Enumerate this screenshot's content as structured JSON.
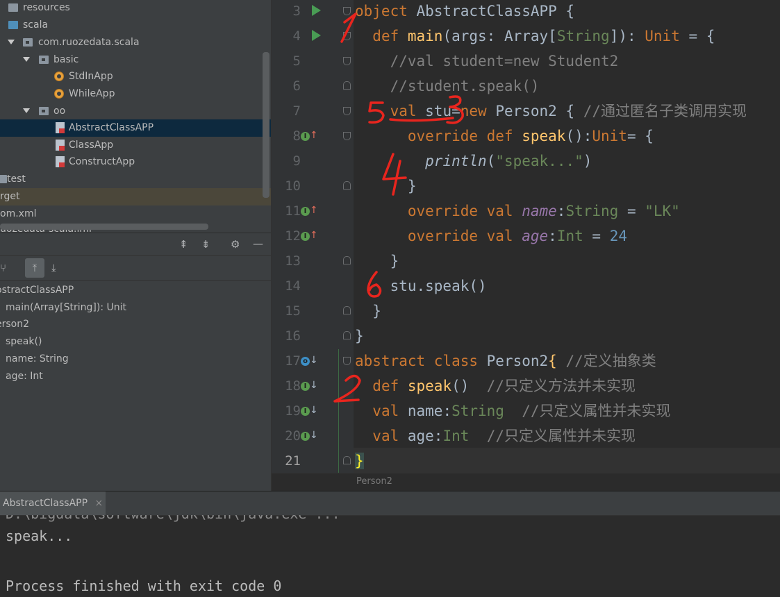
{
  "project_tree": {
    "items": [
      {
        "label": "resources",
        "icon": "folder-resources-icon",
        "depth": 0
      },
      {
        "label": "scala",
        "icon": "folder-source-icon",
        "depth": 0
      },
      {
        "label": "com.ruozedata.scala",
        "icon": "package-icon",
        "depth": 1
      },
      {
        "label": "basic",
        "icon": "package-icon",
        "depth": 2
      },
      {
        "label": "StdInApp",
        "icon": "scala-object-icon",
        "depth": 3
      },
      {
        "label": "WhileApp",
        "icon": "scala-object-icon",
        "depth": 3
      },
      {
        "label": "oo",
        "icon": "package-icon",
        "depth": 2
      },
      {
        "label": "AbstractClassAPP",
        "icon": "scala-file-icon",
        "depth": 3,
        "selected": true
      },
      {
        "label": "ClassApp",
        "icon": "scala-file-icon",
        "depth": 3
      },
      {
        "label": "ConstructApp",
        "icon": "scala-file-icon",
        "depth": 3
      },
      {
        "label": "test",
        "icon": "folder-icon",
        "depth": 0
      },
      {
        "label": "rget",
        "icon": "folder-icon",
        "depth": 0
      },
      {
        "label": "om.xml",
        "icon": "xml-file-icon",
        "depth": 0
      },
      {
        "label": "uozedata-scala.iml",
        "icon": "iml-file-icon",
        "depth": 0
      }
    ]
  },
  "structure": {
    "items": [
      {
        "label": "ostractClassAPP"
      },
      {
        "label": "main(Array[String]): Unit"
      },
      {
        "label": "erson2"
      },
      {
        "label": "speak()"
      },
      {
        "label": "name: String"
      },
      {
        "label": "age: Int"
      }
    ]
  },
  "editor": {
    "line_numbers": [
      "3",
      "4",
      "5",
      "6",
      "7",
      "8",
      "9",
      "10",
      "11",
      "12",
      "13",
      "14",
      "15",
      "16",
      "17",
      "18",
      "19",
      "20",
      "21"
    ],
    "current_line": "21",
    "lines": {
      "l3": {
        "kw": "object",
        "name": " AbstractClassAPP {"
      },
      "l4": {
        "indent": "  ",
        "kw": "def",
        "fn": " main",
        "p1": "(args: Array[",
        "ty": "String",
        "p2": "]): ",
        "ret": "Unit",
        "p3": " = {"
      },
      "l5": {
        "text": "    //val student=new Student2"
      },
      "l6": {
        "text": "    //student.speak()"
      },
      "l7": {
        "indent": "    ",
        "kw": "val",
        "p1": " stu=",
        "kw2": "new",
        "p2": " Person2 { ",
        "cm": "//通过匿名子类调用实现"
      },
      "l8": {
        "indent": "      ",
        "kw": "override def",
        "fn": " speak",
        "p1": "():",
        "ret": "Unit",
        "p2": "= {"
      },
      "l9": {
        "indent": "        ",
        "fn": "println",
        "p1": "(",
        "st": "\"speak...\"",
        "p2": ")"
      },
      "l10": {
        "text": "      }"
      },
      "l11": {
        "indent": "      ",
        "kw": "override val",
        "pr": " name",
        "p1": ":",
        "ty": "String",
        "p2": " = ",
        "st": "\"LK\""
      },
      "l12": {
        "indent": "      ",
        "kw": "override val",
        "pr": " age",
        "p1": ":",
        "ty": "Int",
        "p2": " = ",
        "nm": "24"
      },
      "l13": {
        "text": "    }"
      },
      "l14": {
        "text": "    stu.speak()"
      },
      "l15": {
        "text": "  }"
      },
      "l16": {
        "text": "}"
      },
      "l17": {
        "kw": "abstract class",
        "p1": " Person2",
        "brk": "{",
        "p2": " ",
        "cm": "//定义抽象类"
      },
      "l18": {
        "indent": "  ",
        "kw": "def",
        "fn": " speak",
        "p1": "()  ",
        "cm": "//只定义方法并未实现"
      },
      "l19": {
        "indent": "  ",
        "kw": "val",
        "p1": " name:",
        "ty": "String",
        "p2": "  ",
        "cm": "//只定义属性并未实现"
      },
      "l20": {
        "indent": "  ",
        "kw": "val",
        "p1": " age:",
        "ty": "Int",
        "p2": "  ",
        "cm": "//只定义属性并未实现"
      },
      "l21": {
        "brace": "}"
      }
    },
    "breadcrumb": "Person2"
  },
  "run_panel": {
    "tab_label": "AbstractClassAPP",
    "close_glyph": "×",
    "output_lines": [
      "D:\\bigdata\\software\\jdk\\bin\\java.exe ...",
      "speak...",
      "",
      "Process finished with exit code 0"
    ]
  },
  "annotations": [
    "1",
    "2",
    "3",
    "4",
    "5",
    "6"
  ],
  "colors": {
    "keyword": "#cc7832",
    "function": "#ffc66d",
    "string": "#6a8759",
    "comment": "#808080",
    "number": "#6897bb",
    "annotation": "#e8251e"
  }
}
